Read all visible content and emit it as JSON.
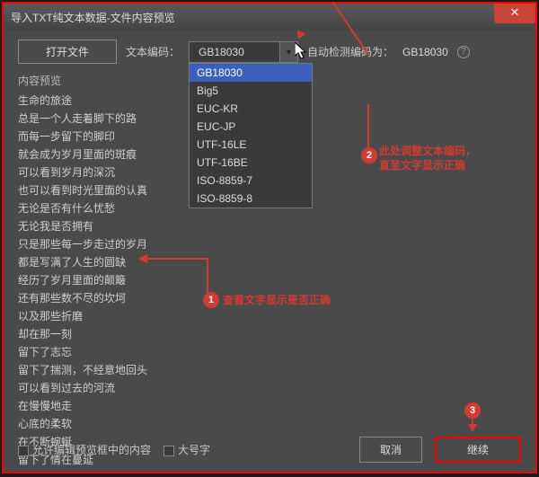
{
  "window": {
    "title": "导入TXT纯文本数据-文件内容预览"
  },
  "toolbar": {
    "open_file": "打开文件",
    "encoding_label": "文本编码：",
    "encoding_value": "GB18030",
    "auto_detect_label": "自动检测编码为：",
    "auto_detect_value": "GB18030"
  },
  "dropdown": {
    "items": [
      "GB18030",
      "Big5",
      "EUC-KR",
      "EUC-JP",
      "UTF-16LE",
      "UTF-16BE",
      "ISO-8859-7",
      "ISO-8859-8"
    ]
  },
  "preview": {
    "header": "内容预览",
    "lines": [
      "生命的旅途",
      "总是一个人走着脚下的路",
      "而每一步留下的脚印",
      "就会成为岁月里面的斑痕",
      "可以看到岁月的深沉",
      "也可以看到时光里面的认真",
      "无论是否有什么忧愁",
      "无论我是否拥有",
      "只是那些每一步走过的岁月",
      "都是写满了人生的圆缺",
      "经历了岁月里面的颠簸",
      "还有那些数不尽的坎坷",
      "以及那些折磨",
      "却在那一刻",
      "留下了志忘",
      "留下了揣测，不经意地回头",
      "可以看到过去的河流",
      "在慢慢地走",
      "心底的柔软",
      "在不断蜿蜒",
      "留下了情在蔓延"
    ]
  },
  "footer": {
    "allow_edit": "允许编辑预览框中的内容",
    "big_font": "大号字",
    "cancel": "取消",
    "continue": "继续"
  },
  "annotations": {
    "note1": "查看文字显示是否正确",
    "note2a": "此处调整文本编码，",
    "note2b": "直至文字显示正确"
  }
}
